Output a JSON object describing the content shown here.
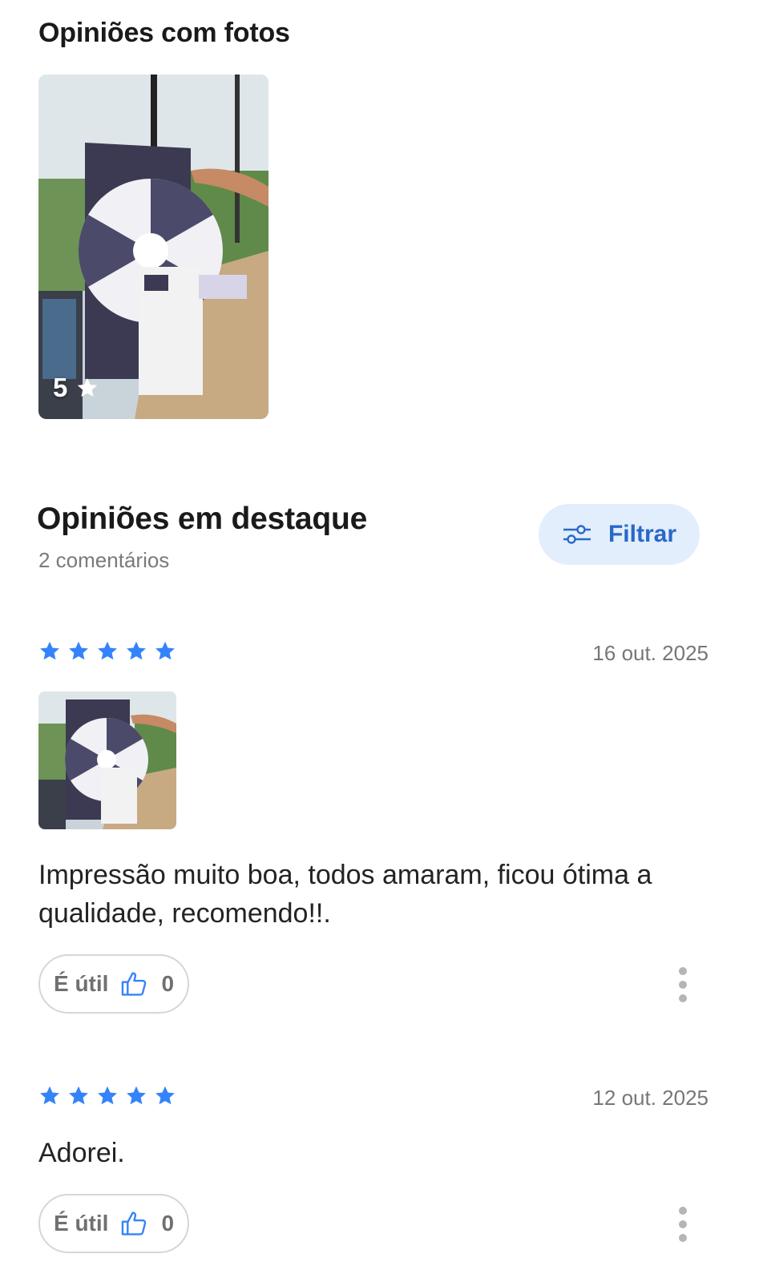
{
  "photos_section": {
    "title": "Opiniões com fotos",
    "photo_rating": "5"
  },
  "highlights": {
    "title": "Opiniões em destaque",
    "count_label": "2 comentários",
    "filter_label": "Filtrar"
  },
  "colors": {
    "star": "#3483fa",
    "accent": "#2968c8",
    "filter_bg": "#e3eefc"
  },
  "reviews": [
    {
      "rating": 5,
      "date": "16 out. 2025",
      "has_photo": true,
      "text": "Impressão muito boa, todos amaram, ficou ótima a qualidade, recomendo!!.",
      "useful_label": "É útil",
      "useful_count": "0"
    },
    {
      "rating": 5,
      "date": "12 out. 2025",
      "has_photo": false,
      "text": "Adorei.",
      "useful_label": "É útil",
      "useful_count": "0"
    }
  ]
}
